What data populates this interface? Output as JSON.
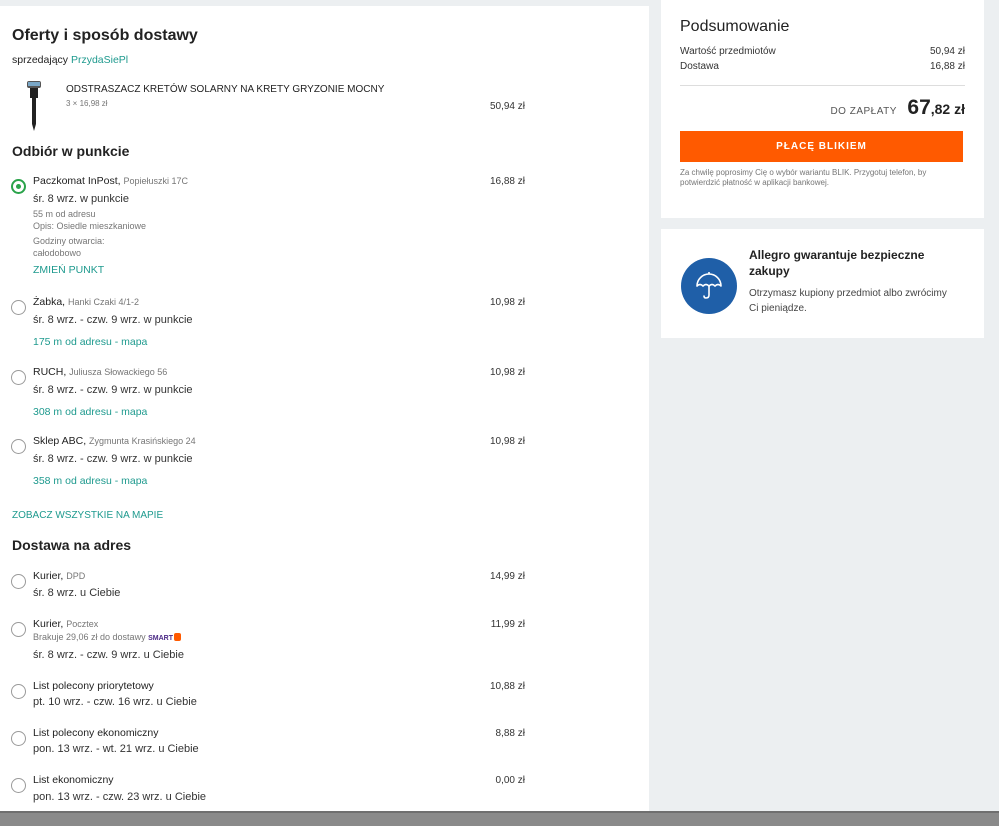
{
  "offers": {
    "title": "Oferty i sposób dostawy",
    "seller_label": "sprzedający",
    "seller_name": "PrzydaSiePl",
    "product": {
      "name": "ODSTRASZACZ KRETÓW SOLARNY NA KRETY GRYZONIE MOCNY",
      "qty_price": "3 × 16,98 zł",
      "total": "50,94 zł"
    }
  },
  "pickup": {
    "title": "Odbiór w punkcie",
    "options": [
      {
        "name": "Paczkomat InPost,",
        "address": "Popiełuszki 17C",
        "date": "śr. 8 wrz. w punkcie",
        "distance": "55 m od adresu",
        "desc": "Opis: Osiedle mieszkaniowe",
        "hours_label": "Godziny otwarcia:",
        "hours_value": "całodobowo",
        "link": "ZMIEŃ PUNKT",
        "price": "16,88 zł",
        "selected": true
      },
      {
        "name": "Żabka,",
        "address": "Hanki Czaki 4/1-2",
        "date": "śr. 8 wrz. - czw. 9 wrz. w punkcie",
        "link": "175 m od adresu - mapa",
        "price": "10,98 zł"
      },
      {
        "name": "RUCH,",
        "address": "Juliusza Słowackiego 56",
        "date": "śr. 8 wrz. - czw. 9 wrz. w punkcie",
        "link": "308 m od adresu - mapa",
        "price": "10,98 zł"
      },
      {
        "name": "Sklep ABC,",
        "address": "Zygmunta Krasińskiego 24",
        "date": "śr. 8 wrz. - czw. 9 wrz. w punkcie",
        "link": "358 m od adresu - mapa",
        "price": "10,98 zł"
      }
    ],
    "see_all": "ZOBACZ WSZYSTKIE NA MAPIE"
  },
  "delivery": {
    "title": "Dostawa na adres",
    "options": [
      {
        "name": "Kurier,",
        "carrier": "DPD",
        "date": "śr. 8 wrz. u Ciebie",
        "price": "14,99 zł"
      },
      {
        "name": "Kurier,",
        "carrier": "Pocztex",
        "note": "Brakuje 29,06 zł do dostawy",
        "smart": "SMART",
        "date": "śr. 8 wrz. - czw. 9 wrz. u Ciebie",
        "price": "11,99 zł"
      },
      {
        "name": "List polecony priorytetowy",
        "date": "pt. 10 wrz. - czw. 16 wrz. u Ciebie",
        "price": "10,88 zł"
      },
      {
        "name": "List polecony ekonomiczny",
        "date": "pon. 13 wrz. - wt. 21 wrz. u Ciebie",
        "price": "8,88 zł"
      },
      {
        "name": "List ekonomiczny",
        "date": "pon. 13 wrz. - czw. 23 wrz. u Ciebie",
        "price": "0,00 zł"
      }
    ]
  },
  "summary": {
    "title": "Podsumowanie",
    "items_label": "Wartość przedmiotów",
    "items_value": "50,94 zł",
    "delivery_label": "Dostawa",
    "delivery_value": "16,88 zł",
    "to_pay_label": "DO ZAPŁATY",
    "to_pay_main": "67",
    "to_pay_cents": ",82 zł",
    "button": "PŁACĘ BLIKIEM",
    "note": "Za chwilę poprosimy Cię o wybór wariantu BLIK. Przygotuj telefon, by potwierdzić płatność w aplikacji bankowej."
  },
  "guarantee": {
    "title": "Allegro gwarantuje bezpieczne zakupy",
    "text": "Otrzymasz kupiony przedmiot albo zwrócimy Ci pieniądze."
  },
  "colors": {
    "accent_orange": "#ff5a00",
    "link_green": "#1e9a8e",
    "radio_green": "#2aa34a",
    "guarantee_blue": "#1f5fa8"
  }
}
